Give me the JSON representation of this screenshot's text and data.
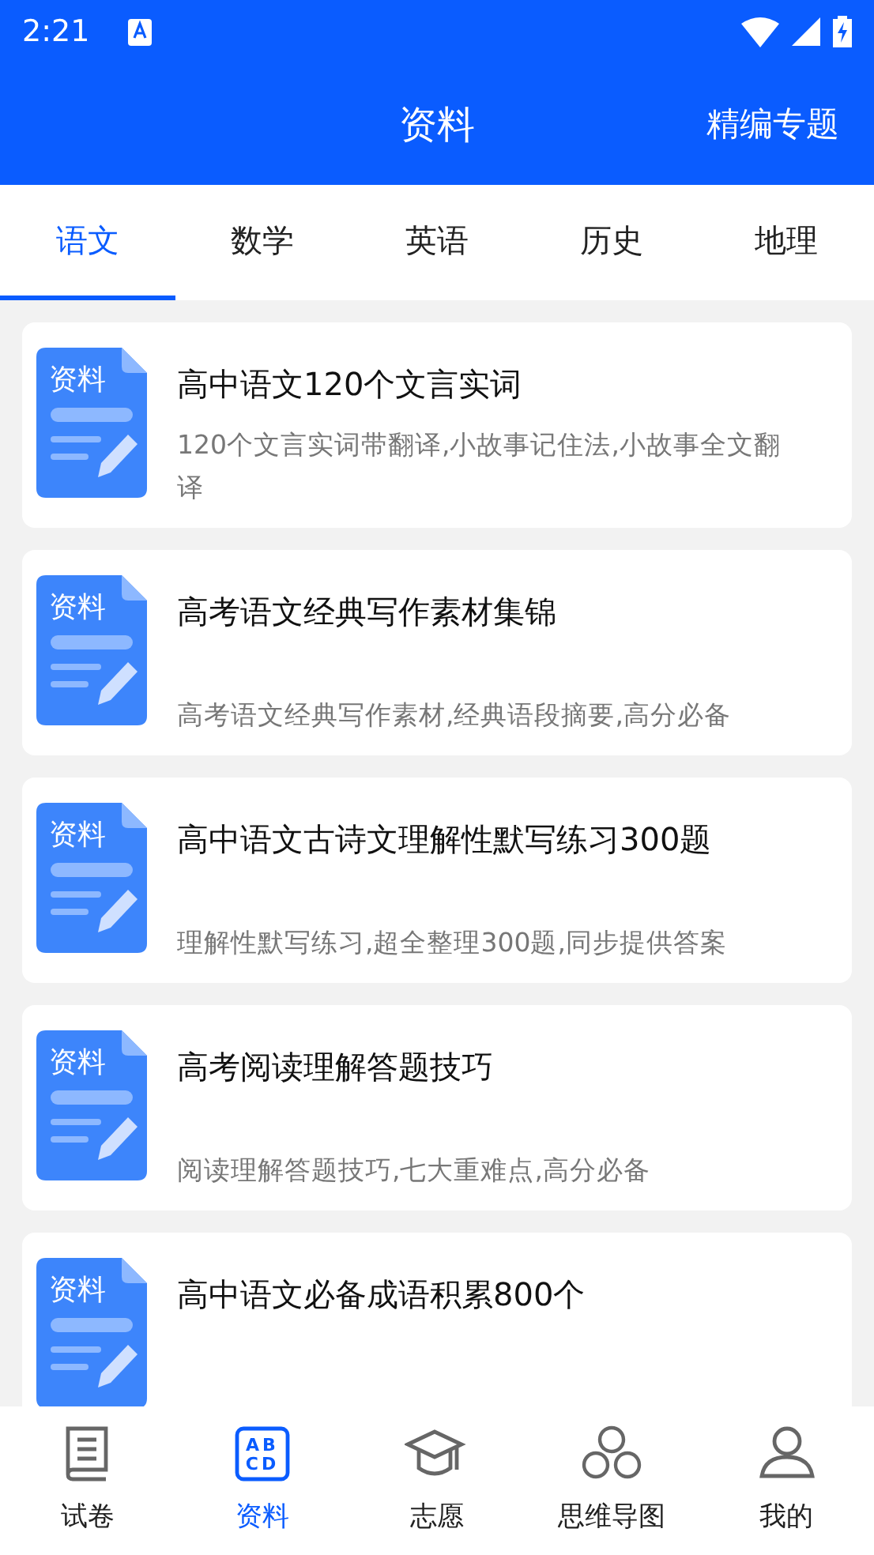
{
  "status_bar": {
    "time": "2:21"
  },
  "header": {
    "title": "资料",
    "action": "精编专题"
  },
  "tabs": [
    {
      "label": "语文",
      "selected": true
    },
    {
      "label": "数学",
      "selected": false
    },
    {
      "label": "英语",
      "selected": false
    },
    {
      "label": "历史",
      "selected": false
    },
    {
      "label": "地理",
      "selected": false
    }
  ],
  "items": [
    {
      "icon_label": "资料",
      "title": "高中语文120个文言实词",
      "description": "120个文言实词带翻译,小故事记住法,小故事全文翻译"
    },
    {
      "icon_label": "资料",
      "title": "高考语文经典写作素材集锦",
      "description": "高考语文经典写作素材,经典语段摘要,高分必备"
    },
    {
      "icon_label": "资料",
      "title": "高中语文古诗文理解性默写练习300题",
      "description": "理解性默写练习,超全整理300题,同步提供答案"
    },
    {
      "icon_label": "资料",
      "title": "高考阅读理解答题技巧",
      "description": "阅读理解答题技巧,七大重难点,高分必备"
    },
    {
      "icon_label": "资料",
      "title": "高中语文必备成语积累800个"
    }
  ],
  "bottom_nav": [
    {
      "kind": "book",
      "label": "试卷",
      "selected": false
    },
    {
      "kind": "letters",
      "icon_text": [
        "AB",
        "CD"
      ],
      "label": "资料",
      "selected": true
    },
    {
      "kind": "cap",
      "label": "志愿",
      "selected": false
    },
    {
      "kind": "circles",
      "label": "思维导图",
      "selected": false
    },
    {
      "kind": "person",
      "label": "我的",
      "selected": false
    }
  ]
}
